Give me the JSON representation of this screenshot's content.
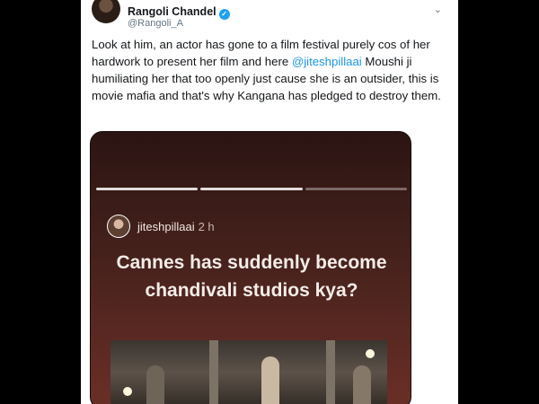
{
  "tweet": {
    "author_name": "Rangoli Chandel",
    "handle": "@Rangoli_A",
    "text_part1": "Look at him, an actor has gone to a film festival purely cos of her hardwork to present her film and here ",
    "mention": "@jiteshpillaai",
    "text_part2": " Moushi ji humiliating her that too openly just cause she is an outsider, this is movie mafia and that's why Kangana has pledged to destroy them."
  },
  "story": {
    "username": "jiteshpillaai",
    "time": "2 h",
    "caption": "Cannes has suddenly become chandivali studios kya?"
  },
  "colors": {
    "link": "#1b95e0",
    "verified": "#1da1f2",
    "text": "#14171a",
    "muted": "#657786"
  },
  "icons": [
    "avatar",
    "verified-badge-icon",
    "chevron-down-icon",
    "story-avatar"
  ]
}
